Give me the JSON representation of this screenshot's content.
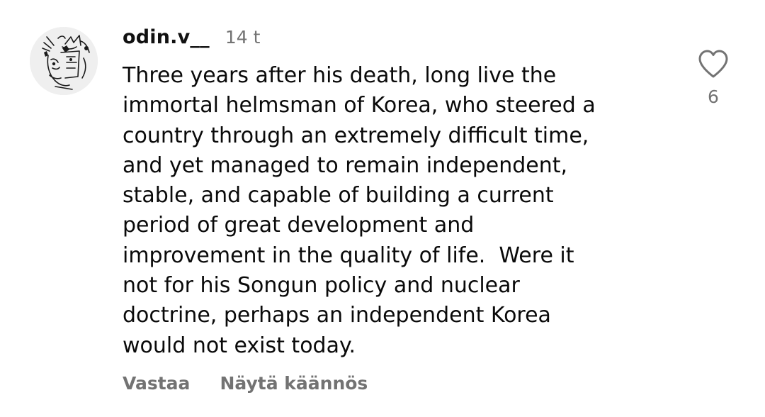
{
  "comment": {
    "author": "odin.v__",
    "time": "14 t",
    "text_lines": [
      "Three years after his death, long live the",
      "immortal helmsman of Korea, who steered a",
      "country through an extremely difficult time,",
      "and yet managed to remain independent,",
      "stable, and capable of building a current",
      "period of great development and",
      "improvement in the quality of life.  Were it",
      "not for his Songun policy and nuclear",
      "doctrine, perhaps an independent Korea",
      "would not exist today."
    ],
    "actions": {
      "reply": "Vastaa",
      "translate": "Näytä käännös"
    },
    "likes": {
      "icon": "heart-icon",
      "count": "6"
    }
  }
}
